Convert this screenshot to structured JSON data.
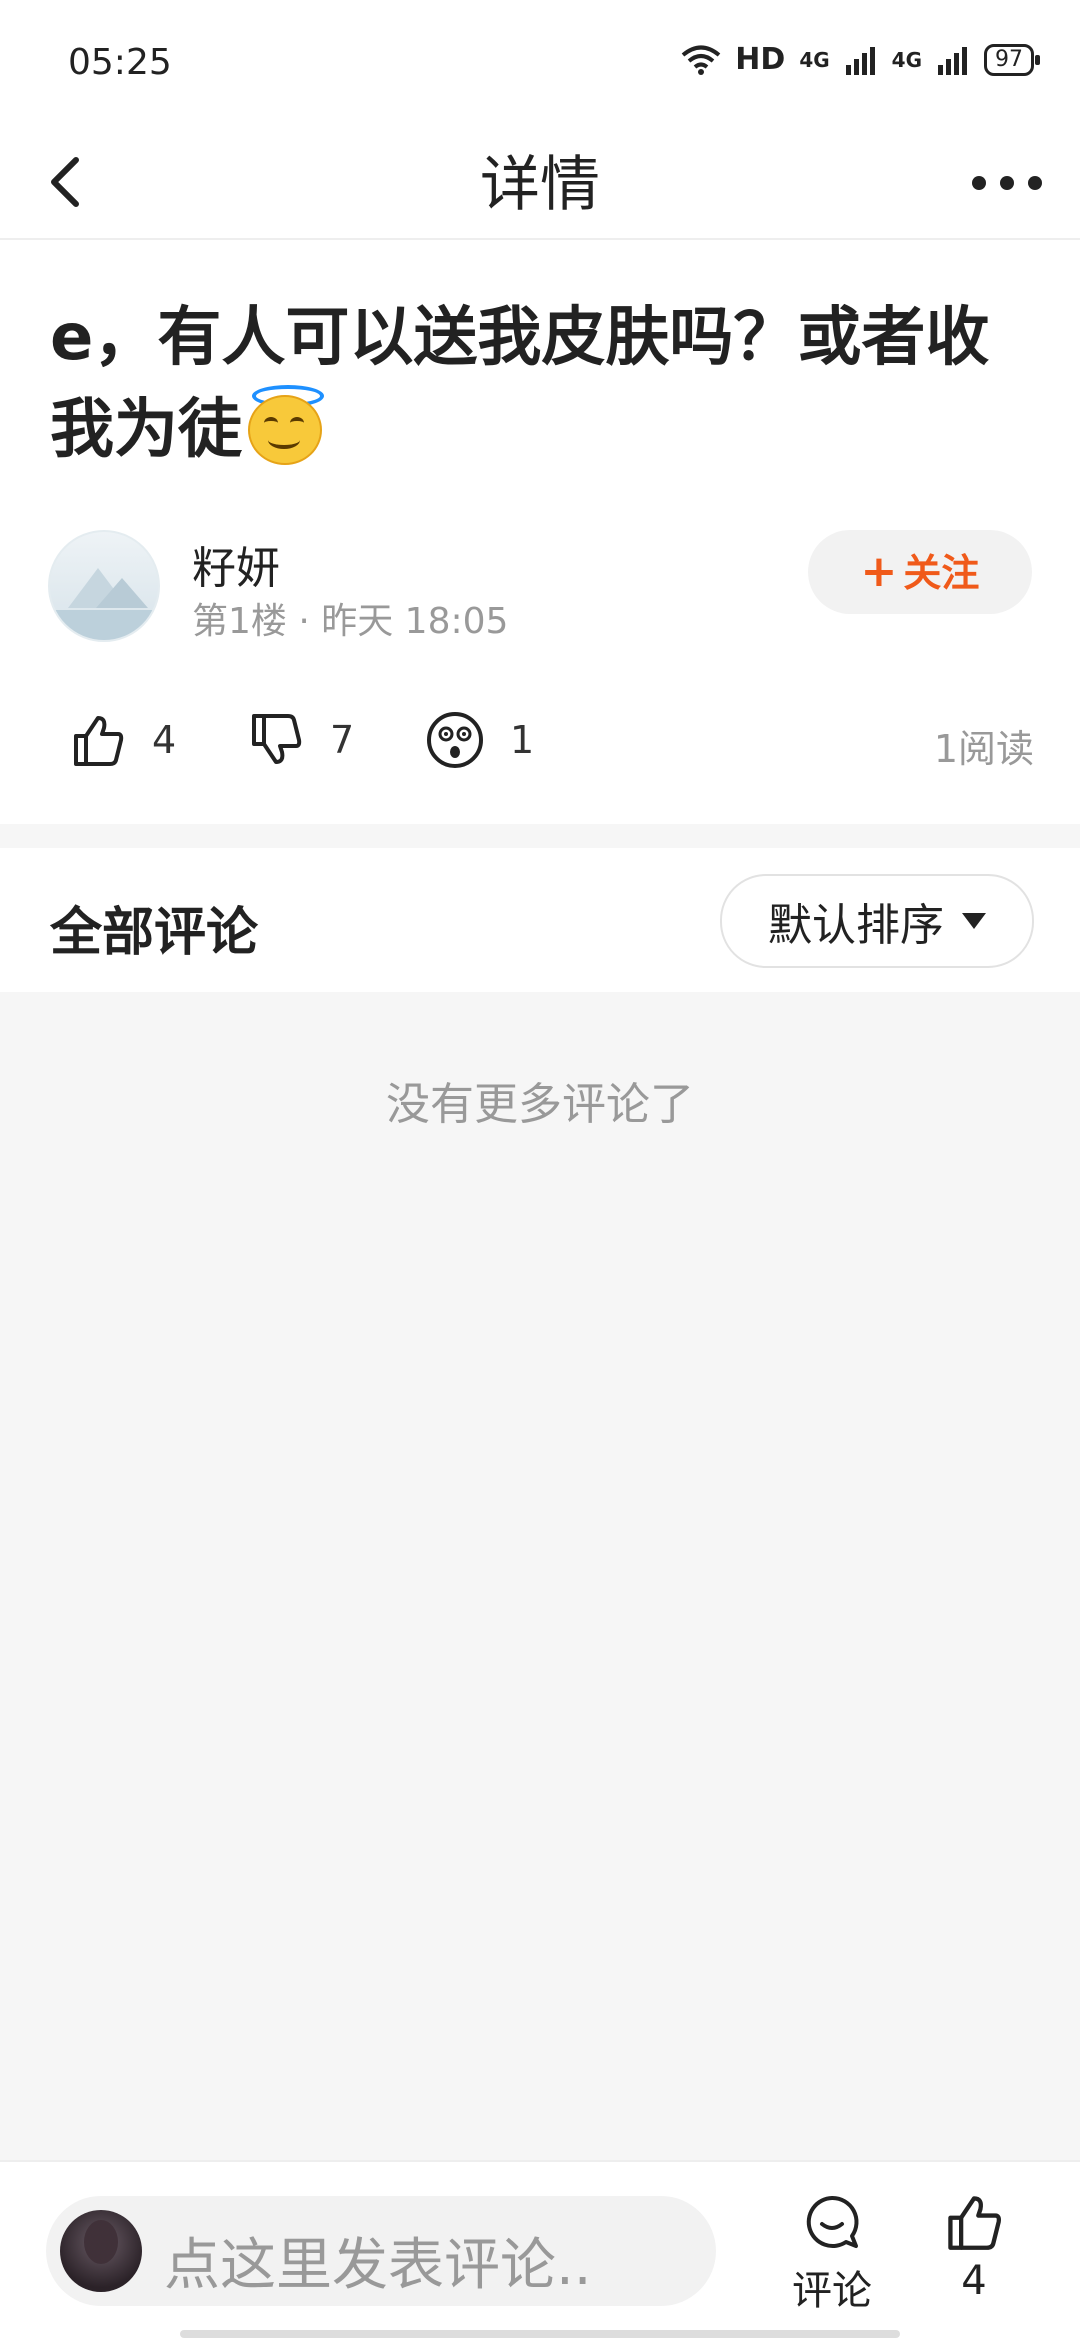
{
  "status_bar": {
    "time": "05:25",
    "network_label": "HD",
    "signal_1": "4G",
    "signal_2": "4G",
    "battery": "97"
  },
  "nav": {
    "title": "详情"
  },
  "post": {
    "title": "e，有人可以送我皮肤吗？或者收我为徒",
    "title_emoji": "smiling-face-with-halo",
    "author": {
      "name": "籽妍",
      "meta": "第1楼 · 昨天 18:05"
    },
    "follow_label": "关注",
    "reactions": {
      "likes": "4",
      "dislikes": "7",
      "shocked": "1"
    },
    "views": "1阅读"
  },
  "comments": {
    "title": "全部评论",
    "sort_label": "默认排序",
    "empty_text": "没有更多评论了"
  },
  "bottom_bar": {
    "input_placeholder": "点这里发表评论..",
    "comment_label": "评论",
    "like_count": "4"
  },
  "colors": {
    "accent": "#f05a1a",
    "muted_text": "#999999",
    "background": "#f6f6f6"
  }
}
